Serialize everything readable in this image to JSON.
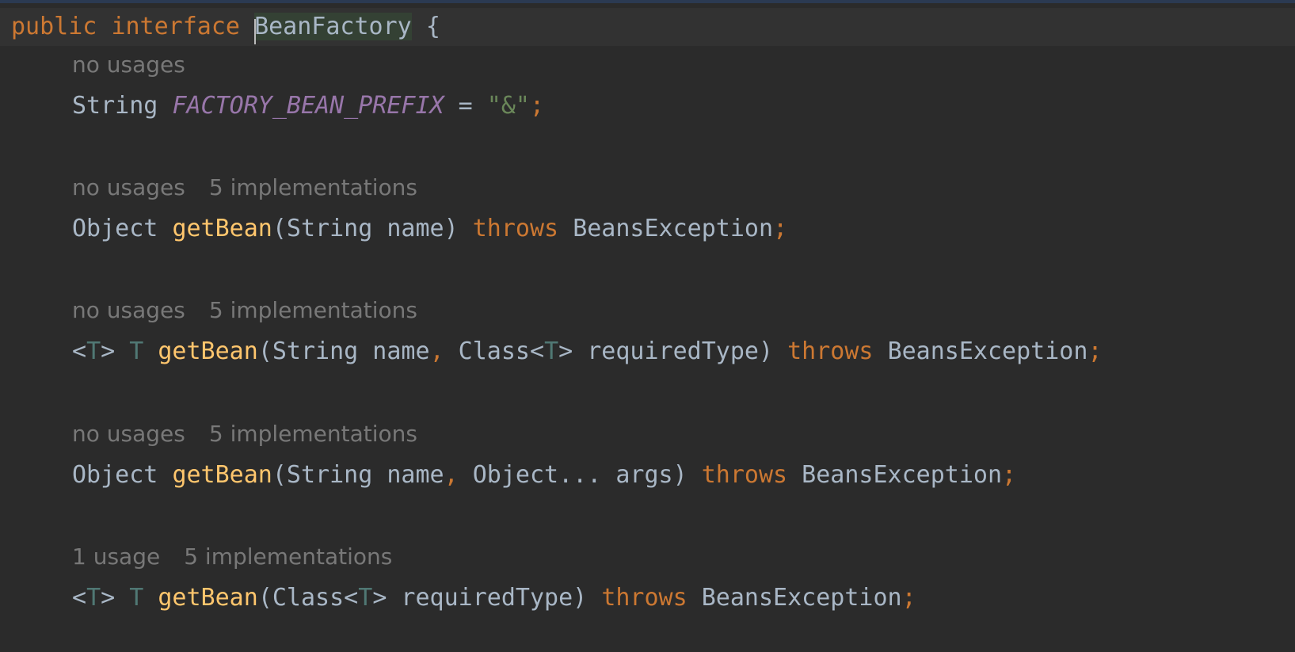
{
  "editor": {
    "declaration": {
      "keyword_public": "public",
      "keyword_interface": "interface",
      "name": "BeanFactory",
      "brace": "{"
    },
    "members": [
      {
        "hint_usages": "no usages",
        "hint_impl": "",
        "type": "String",
        "const_name": "FACTORY_BEAN_PREFIX",
        "eq": " = ",
        "value": "\"&\"",
        "semi": ";"
      },
      {
        "hint_usages": "no usages",
        "hint_impl": "5 implementations",
        "ret": "Object",
        "method": "getBean",
        "params": "(String name)",
        "throws_kw": "throws",
        "exception": "BeansException",
        "semi": ";"
      },
      {
        "hint_usages": "no usages",
        "hint_impl": "5 implementations",
        "generic_open": "<",
        "generic_t": "T",
        "generic_close": ">",
        "ret_t": "T",
        "method": "getBean",
        "p1": "(String name",
        "comma": ",",
        "p2a": " Class<",
        "p2t": "T",
        "p2b": "> requiredType)",
        "throws_kw": "throws",
        "exception": "BeansException",
        "semi": ";"
      },
      {
        "hint_usages": "no usages",
        "hint_impl": "5 implementations",
        "ret": "Object",
        "method": "getBean",
        "p1": "(String name",
        "comma": ",",
        "p2": " Object... args)",
        "throws_kw": "throws",
        "exception": "BeansException",
        "semi": ";"
      },
      {
        "hint_usages": "1 usage",
        "hint_impl": "5 implementations",
        "generic_open": "<",
        "generic_t": "T",
        "generic_close": ">",
        "ret_t": "T",
        "method": "getBean",
        "p1a": "(Class<",
        "p1t": "T",
        "p1b": "> requiredType)",
        "throws_kw": "throws",
        "exception": "BeansException",
        "semi": ";"
      }
    ]
  }
}
